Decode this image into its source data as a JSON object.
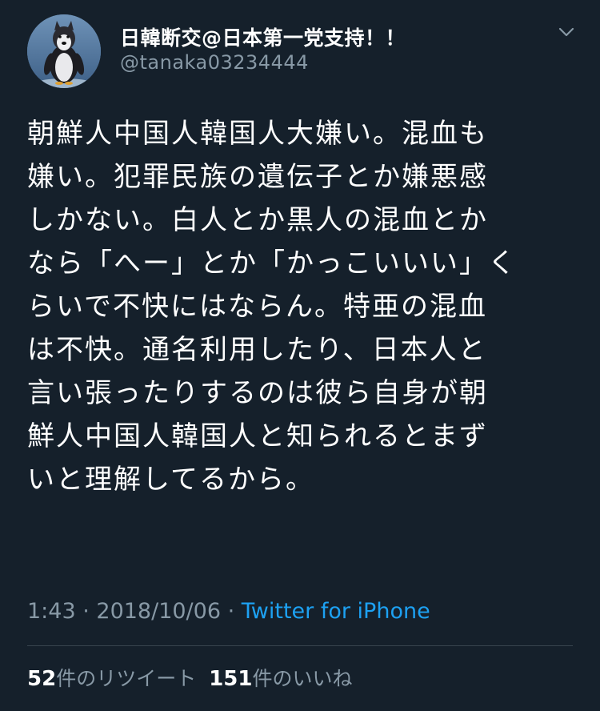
{
  "user": {
    "display_name": "日韓断交@日本第一党支持！！",
    "handle": "@tanaka03234444"
  },
  "menu_icon": "chevron-down-icon",
  "tweet": {
    "lines": [
      "朝鮮人中国人韓国人大嫌い。混血も",
      "嫌い。犯罪民族の遺伝子とか嫌悪感",
      "しかない。白人とか黒人の混血とか",
      "なら「へー」とか「かっこいいい」く",
      "らいで不快にはならん。特亜の混血",
      "は不快。通名利用したり、日本人と",
      "言い張ったりするのは彼ら自身が朝",
      "鮮人中国人韓国人と知られるとまず",
      "いと理解してるから。"
    ]
  },
  "meta": {
    "time": "1:43",
    "sep1": " · ",
    "date": "2018/10/06",
    "sep2": " · ",
    "source": "Twitter for iPhone"
  },
  "stats": {
    "retweets_count": "52",
    "retweets_label": "件のリツイート",
    "likes_count": "151",
    "likes_label": "件のいいね"
  },
  "colors": {
    "background": "#15202b",
    "secondary_text": "#8899a6",
    "link": "#1da1f2",
    "divider": "#38444d"
  }
}
